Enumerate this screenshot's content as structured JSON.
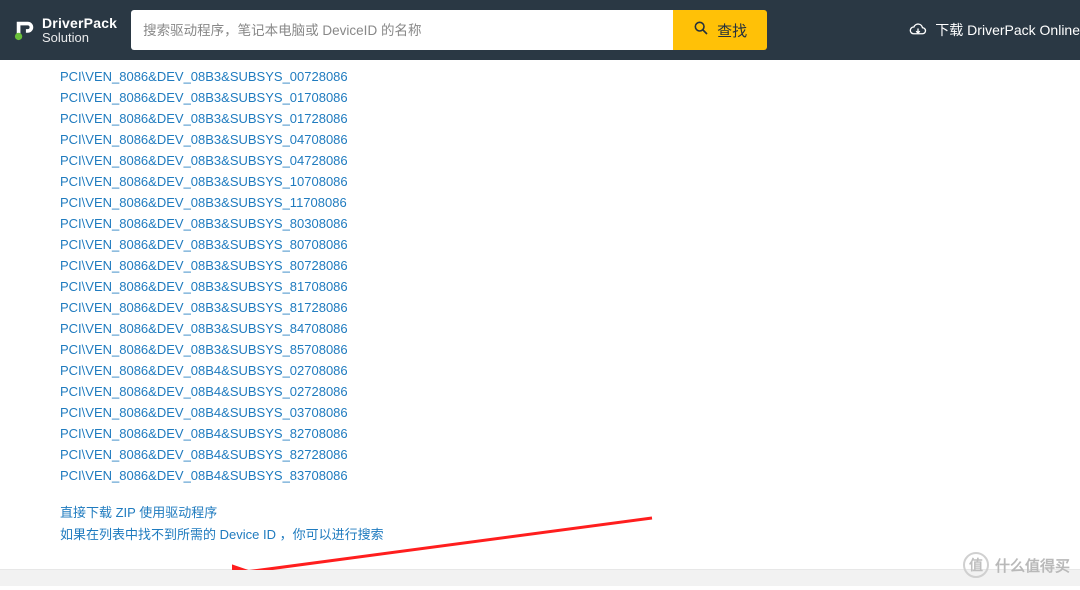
{
  "header": {
    "brand_line1": "DriverPack",
    "brand_line2": "Solution",
    "search_placeholder": "搜索驱动程序，笔记本电脑或 DeviceID 的名称",
    "search_button": "查找",
    "download_online": "下载 DriverPack Online"
  },
  "device_ids": [
    "PCI\\VEN_8086&DEV_08B3&SUBSYS_00728086",
    "PCI\\VEN_8086&DEV_08B3&SUBSYS_01708086",
    "PCI\\VEN_8086&DEV_08B3&SUBSYS_01728086",
    "PCI\\VEN_8086&DEV_08B3&SUBSYS_04708086",
    "PCI\\VEN_8086&DEV_08B3&SUBSYS_04728086",
    "PCI\\VEN_8086&DEV_08B3&SUBSYS_10708086",
    "PCI\\VEN_8086&DEV_08B3&SUBSYS_11708086",
    "PCI\\VEN_8086&DEV_08B3&SUBSYS_80308086",
    "PCI\\VEN_8086&DEV_08B3&SUBSYS_80708086",
    "PCI\\VEN_8086&DEV_08B3&SUBSYS_80728086",
    "PCI\\VEN_8086&DEV_08B3&SUBSYS_81708086",
    "PCI\\VEN_8086&DEV_08B3&SUBSYS_81728086",
    "PCI\\VEN_8086&DEV_08B3&SUBSYS_84708086",
    "PCI\\VEN_8086&DEV_08B3&SUBSYS_85708086",
    "PCI\\VEN_8086&DEV_08B4&SUBSYS_02708086",
    "PCI\\VEN_8086&DEV_08B4&SUBSYS_02728086",
    "PCI\\VEN_8086&DEV_08B4&SUBSYS_03708086",
    "PCI\\VEN_8086&DEV_08B4&SUBSYS_82708086",
    "PCI\\VEN_8086&DEV_08B4&SUBSYS_82728086",
    "PCI\\VEN_8086&DEV_08B4&SUBSYS_83708086"
  ],
  "bottom_links": {
    "zip": "直接下载 ZIP 使用驱动程序",
    "search_hint": "如果在列表中找不到所需的 Device ID ，你可以进行搜索"
  },
  "watermark": {
    "badge": "值",
    "text": "什么值得买"
  }
}
